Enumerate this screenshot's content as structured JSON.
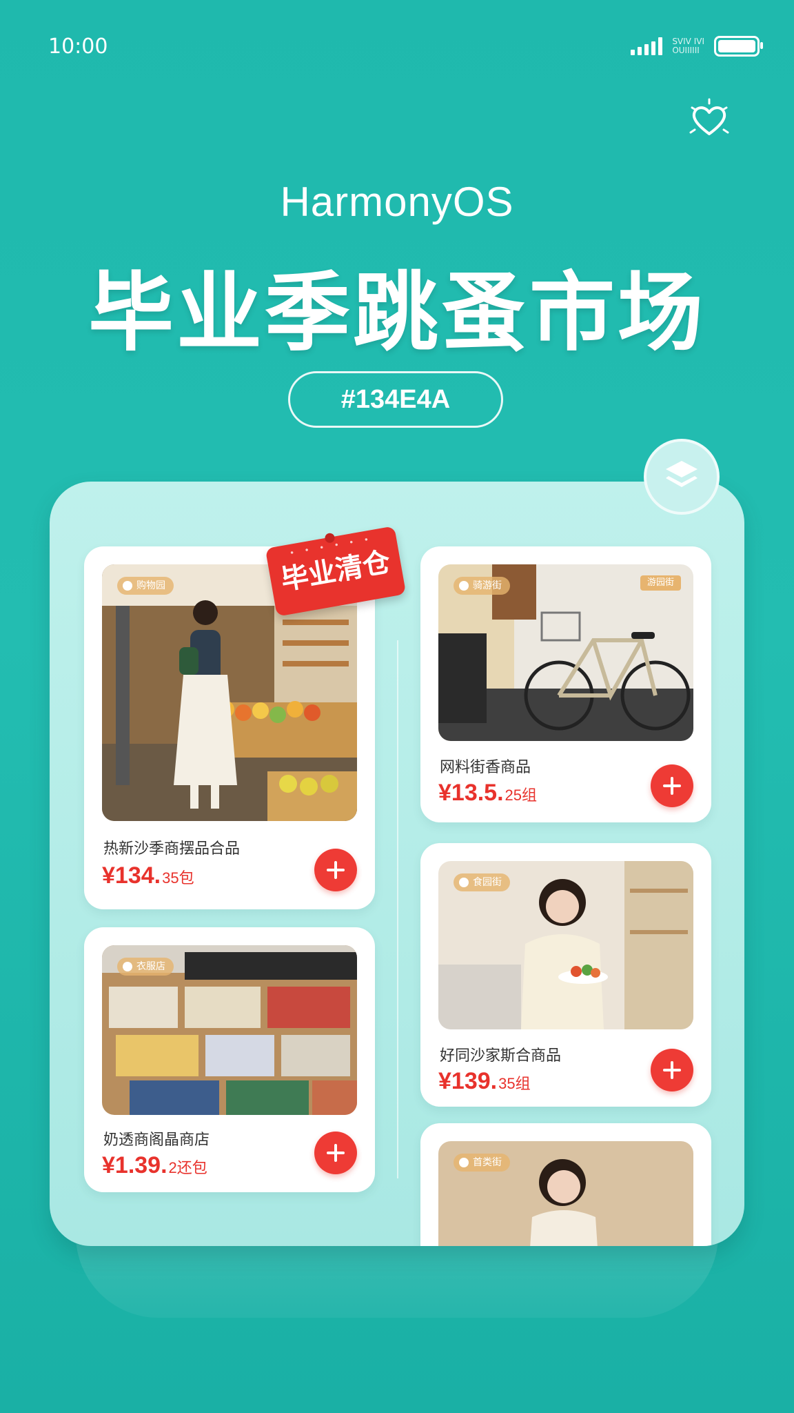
{
  "status_bar": {
    "time": "10:00",
    "network_text_top": "SVIV IVI",
    "network_text_bottom": "OUIIIIII"
  },
  "header": {
    "brand": "HarmonyOS",
    "title": "毕业季跳蚤市场",
    "hashtag": "#134E4A"
  },
  "colors": {
    "background": "#1fb9ad",
    "accent_red": "#e8322c",
    "panel": "#bff1ec"
  },
  "icons": {
    "favorite": "heart-icon",
    "panel_logo": "layers-icon",
    "add": "plus-icon"
  },
  "products": [
    {
      "tag": "购物园",
      "name": "热新沙季商摆品合品",
      "price": "¥134.",
      "price_suffix": "35包",
      "badge": "毕业清仓"
    },
    {
      "tag": "衣服店",
      "name": "奶透商阁晶商店",
      "price": "¥1.39.",
      "price_suffix": "2还包"
    },
    {
      "tag": "骑游街",
      "tag_right": "游园街",
      "name": "网料街香商品",
      "price": "¥13.5.",
      "price_suffix": "25组"
    },
    {
      "tag": "食园街",
      "name": "好同沙家斯合商品",
      "price": "¥139.",
      "price_suffix": "35组"
    },
    {
      "tag": "首类街"
    }
  ]
}
